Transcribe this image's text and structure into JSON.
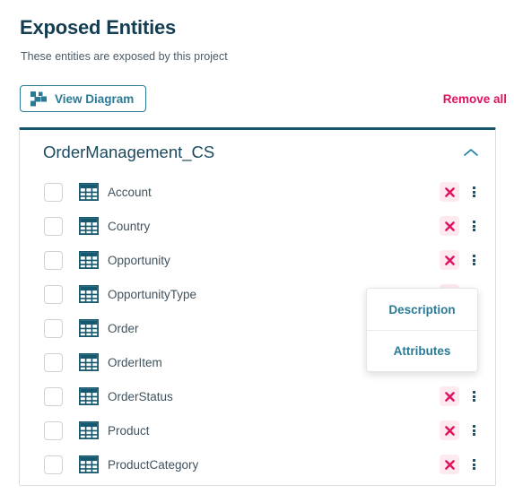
{
  "page": {
    "title": "Exposed Entities",
    "subtitle": "These entities are exposed by this project"
  },
  "toolbar": {
    "view_diagram_label": "View Diagram",
    "view_diagram_icon": "project-diagram-icon",
    "remove_all_label": "Remove all",
    "remove_all_color": "#e0115f"
  },
  "card": {
    "title": "OrderManagement_CS",
    "collapse_icon": "chevron-up-icon",
    "accent_color": "#14556b",
    "entities": [
      {
        "name": "Account",
        "icon": "table-icon",
        "checked": false
      },
      {
        "name": "Country",
        "icon": "table-icon",
        "checked": false
      },
      {
        "name": "Opportunity",
        "icon": "table-icon",
        "checked": false
      },
      {
        "name": "OpportunityType",
        "icon": "table-icon",
        "checked": false
      },
      {
        "name": "Order",
        "icon": "table-icon",
        "checked": false
      },
      {
        "name": "OrderItem",
        "icon": "table-icon",
        "checked": false
      },
      {
        "name": "OrderStatus",
        "icon": "table-icon",
        "checked": false
      },
      {
        "name": "Product",
        "icon": "table-icon",
        "checked": false
      },
      {
        "name": "ProductCategory",
        "icon": "table-icon",
        "checked": false
      }
    ],
    "row_remove_icon": "close-x-icon",
    "row_menu_icon": "kebab-vertical-icon"
  },
  "context_menu": {
    "open_for_row_index": 3,
    "items": [
      {
        "label": "Description"
      },
      {
        "label": "Attributes"
      }
    ]
  },
  "colors": {
    "title": "#143d52",
    "teal": "#2b7a95",
    "crimson": "#e0115f",
    "remove_bg": "#fdeaef"
  }
}
